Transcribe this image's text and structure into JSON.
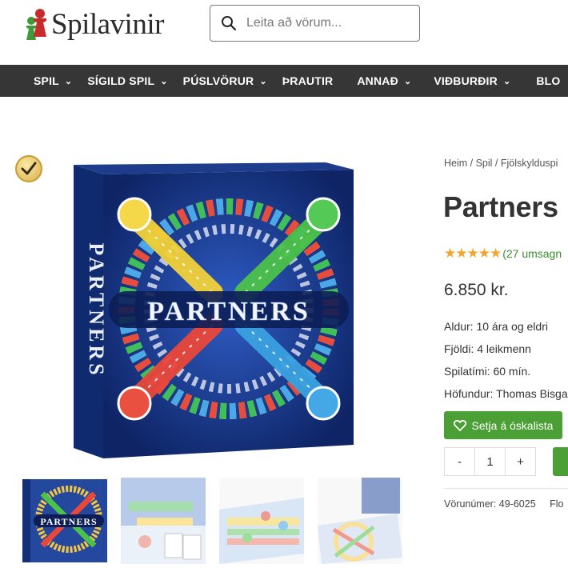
{
  "header": {
    "logo_text": "Spilavinir",
    "search_placeholder": "Leita að vörum..."
  },
  "nav": {
    "items": [
      {
        "label": "SPIL",
        "has_dropdown": true
      },
      {
        "label": "SÍGILD SPIL",
        "has_dropdown": true
      },
      {
        "label": "PÚSLVÖRUR",
        "has_dropdown": true
      },
      {
        "label": "ÞRAUTIR",
        "has_dropdown": false
      },
      {
        "label": "ANNAÐ",
        "has_dropdown": true
      },
      {
        "label": "VIÐBURÐIR",
        "has_dropdown": true
      },
      {
        "label": "BLO",
        "has_dropdown": false
      }
    ]
  },
  "gallery": {
    "box_title": "PARTNERS",
    "side_title": "PARTNERS",
    "thumb_title": "PARTNERS"
  },
  "product": {
    "breadcrumb": [
      "Heim",
      "Spil",
      "Fjölskylduspi"
    ],
    "title": "Partners",
    "stars": "★★★★★",
    "reviews": "(27 umsagn",
    "price": "6.850 kr.",
    "attributes": [
      "Aldur: 10 ára og eldri",
      "Fjöldi: 4 leikmenn",
      "Spilatími: 60 mín.",
      "Höfundur: Thomas Bisga"
    ],
    "wishlist_label": "Setja á óskalista",
    "qty_minus": "-",
    "qty_value": "1",
    "qty_plus": "+",
    "sku": "Vörunúmer: 49-6025",
    "sku_extra": "Flo"
  },
  "colors": {
    "nav_bg": "#363636",
    "accent_green": "#4ba035",
    "star": "#f0a62b",
    "box_blue": "#1b3c8e"
  }
}
